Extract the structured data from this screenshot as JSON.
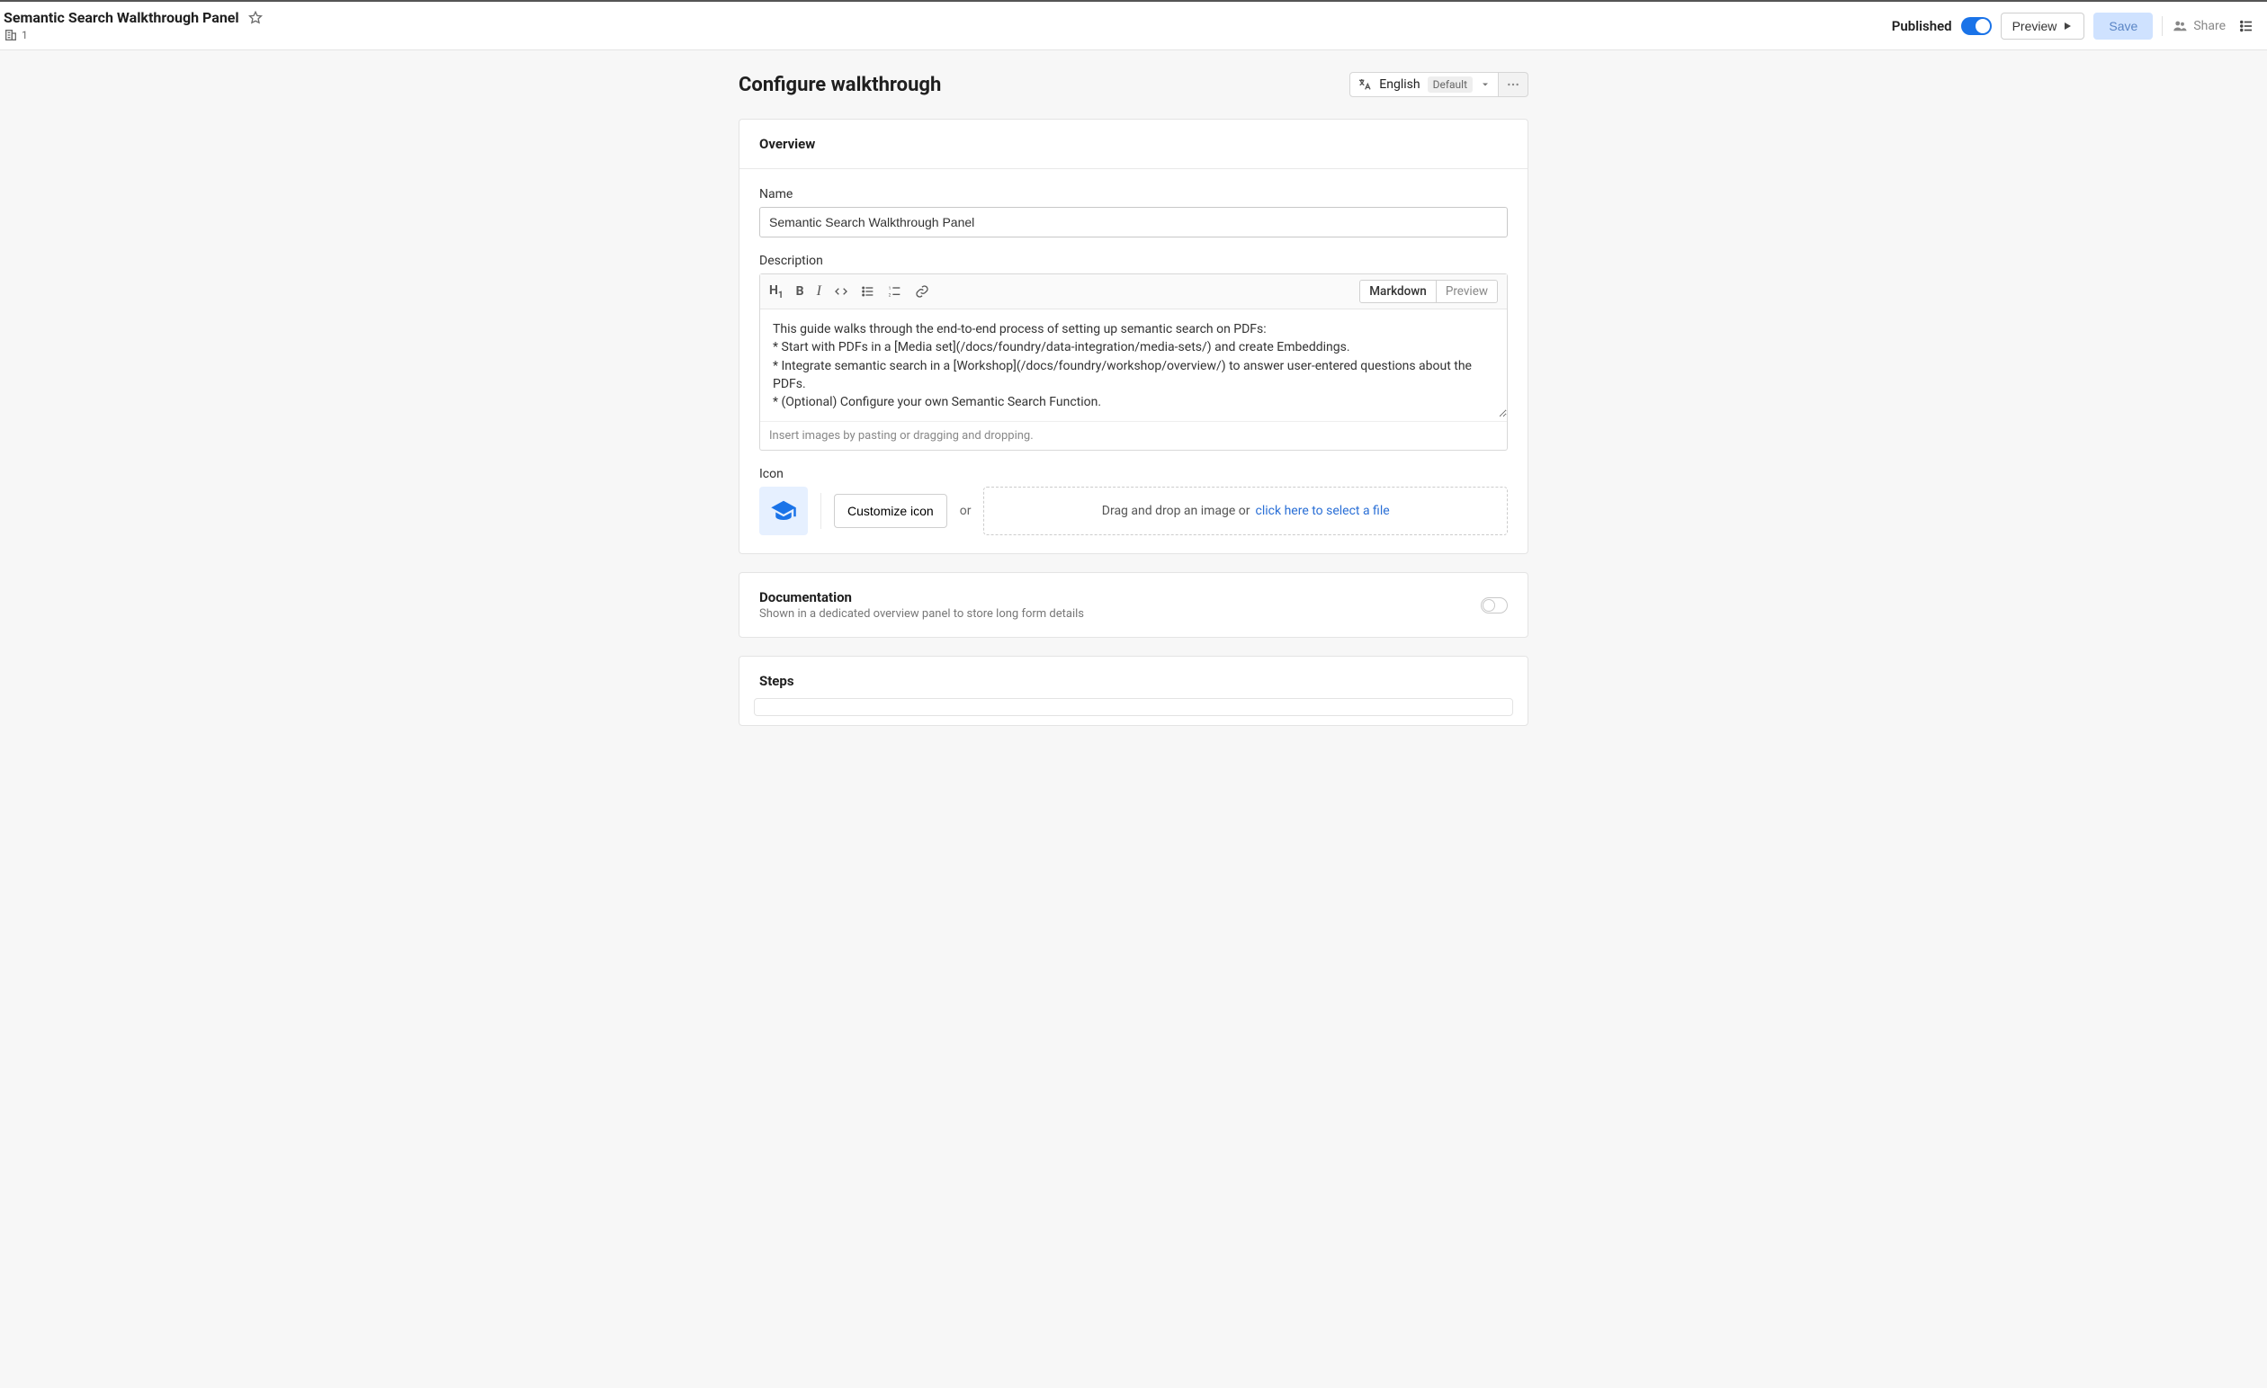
{
  "topbar": {
    "title": "Semantic Search Walkthrough Panel",
    "building_count": "1",
    "published_label": "Published",
    "preview_label": "Preview",
    "save_label": "Save",
    "share_label": "Share"
  },
  "page": {
    "heading": "Configure walkthrough",
    "language": "English",
    "language_default": "Default"
  },
  "overview": {
    "panel_title": "Overview",
    "name_label": "Name",
    "name_value": "Semantic Search Walkthrough Panel",
    "description_label": "Description",
    "description_value": "This guide walks through the end-to-end process of setting up semantic search on PDFs:\n* Start with PDFs in a [Media set](/docs/foundry/data-integration/media-sets/) and create Embeddings.\n* Integrate semantic search in a [Workshop](/docs/foundry/workshop/overview/) to answer user-entered questions about the PDFs.\n* (Optional) Configure your own Semantic Search Function.",
    "editor_tabs": {
      "markdown": "Markdown",
      "preview": "Preview"
    },
    "editor_hint": "Insert images by pasting or dragging and dropping.",
    "icon_label": "Icon",
    "customize_icon": "Customize icon",
    "or_text": "or",
    "dropzone_text": "Drag and drop an image or",
    "dropzone_link": "click here to select a file"
  },
  "documentation": {
    "title": "Documentation",
    "subtitle": "Shown in a dedicated overview panel to store long form details"
  },
  "steps": {
    "title": "Steps"
  }
}
